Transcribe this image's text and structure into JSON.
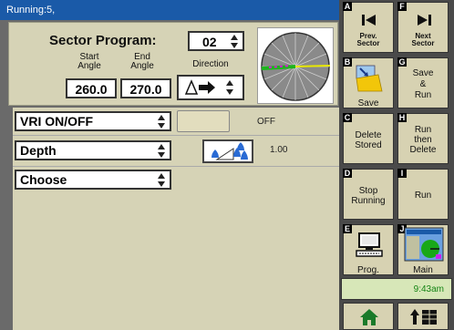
{
  "status": {
    "title": "Running:5,"
  },
  "sector": {
    "label": "Sector Program:",
    "value": "02",
    "start_label_1": "Start",
    "start_label_2": "Angle",
    "end_label_1": "End",
    "end_label_2": "Angle",
    "direction_label": "Direction",
    "start_angle": "260.0",
    "end_angle": "270.0"
  },
  "rows": [
    {
      "select": "VRI ON/OFF",
      "value": "OFF"
    },
    {
      "select": "Depth",
      "value": "1.00"
    },
    {
      "select": "Choose"
    }
  ],
  "buttons": {
    "A": {
      "letter": "A",
      "line1": "Prev.",
      "line2": "Sector"
    },
    "F": {
      "letter": "F",
      "line1": "Next",
      "line2": "Sector"
    },
    "B": {
      "letter": "B",
      "label": "Save"
    },
    "G": {
      "letter": "G",
      "line1": "Save",
      "line2": "&",
      "line3": "Run"
    },
    "C": {
      "letter": "C",
      "line1": "Delete",
      "line2": "Stored"
    },
    "H": {
      "letter": "H",
      "line1": "Run",
      "line2": "then",
      "line3": "Delete"
    },
    "D": {
      "letter": "D",
      "line1": "Stop",
      "line2": "Running"
    },
    "I": {
      "letter": "I",
      "label": "Run"
    },
    "E": {
      "letter": "E",
      "label": "Prog."
    },
    "J": {
      "letter": "J",
      "label": "Main"
    }
  },
  "clock": "9:43am",
  "icons": {
    "prev": "skip-back-icon",
    "next": "skip-forward-icon",
    "save": "folder-save-icon",
    "prog": "computer-icon",
    "main": "map-screen-icon",
    "home": "home-icon",
    "nav": "up-grid-icon",
    "depth": "water-drops-icon",
    "direction": "direction-arrow-icon"
  },
  "colors": {
    "titlebar": "#1a5aa8",
    "panel": "#d6d3b6",
    "button": "#d7d2b2",
    "clock_text": "#148414"
  }
}
